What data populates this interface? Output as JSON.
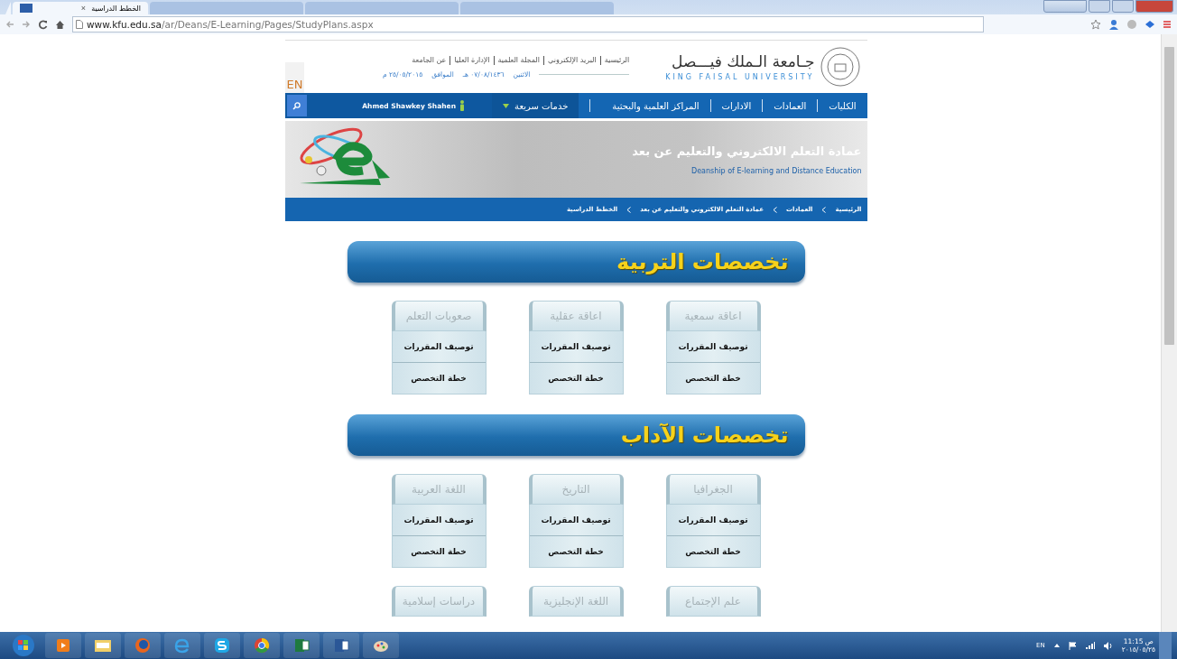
{
  "browser": {
    "tab_title": "الخطط الدراسية",
    "tab_close": "×",
    "url_host": "www.kfu.edu.sa",
    "url_path": "/ar/Deans/E-Learning/Pages/StudyPlans.aspx"
  },
  "header": {
    "links": [
      "الرئيسية",
      "البريد الإلكتروني",
      "المجلة العلمية",
      "الإدارة العليا",
      "عن الجامعة"
    ],
    "day": "الاثنين",
    "hijri": "٠٧/٠٨/١٤٣٦ هـ",
    "agree": "الموافق",
    "gregorian": "٢٥/٠٥/٢٠١٥ م",
    "university_ar": "جـامعة الـملك فيـــصل",
    "university_en": "KING FAISAL UNIVERSITY",
    "language": "EN"
  },
  "nav": {
    "items": [
      "الكليات",
      "العمادات",
      "الادارات",
      "المراكز العلمية والبحثية"
    ],
    "quick": "خدمات سريعة",
    "user": "Ahmed Shawkey Shahen"
  },
  "banner": {
    "title_ar": "عمادة التعلم الالكتروني والتعليم عن بعد",
    "title_en": "Deanship of E-learning and Distance Education"
  },
  "breadcrumb": [
    "الرئيسية",
    "العمادات",
    "عمادة التعلم الالكتروني والتعليم عن بعد",
    "الخطط الدراسية"
  ],
  "sections": [
    {
      "title": "تخصصات التربية",
      "cards": [
        {
          "title": "اعاقة سمعية",
          "links": [
            "توصيف المقررات",
            "خطة التخصص"
          ]
        },
        {
          "title": "اعاقة عقلية",
          "links": [
            "توصيف المقررات",
            "خطة التخصص"
          ]
        },
        {
          "title": "صعوبات التعلم",
          "links": [
            "توصيف المقررات",
            "خطة التخصص"
          ]
        }
      ]
    },
    {
      "title": "تخصصات الآداب",
      "cards": [
        {
          "title": "الجغرافيا",
          "links": [
            "توصيف المقررات",
            "خطة التخصص"
          ]
        },
        {
          "title": "التاريخ",
          "links": [
            "توصيف المقررات",
            "خطة التخصص"
          ]
        },
        {
          "title": "اللغة العربية",
          "links": [
            "توصيف المقررات",
            "خطة التخصص"
          ]
        },
        {
          "title": "علم الإجتماع"
        },
        {
          "title": "اللغة الإنجليزية"
        },
        {
          "title": "دراسات إسلامية"
        }
      ]
    }
  ],
  "taskbar": {
    "language": "EN",
    "time": "11:15 ص",
    "date": "٢٠١٥/٠٥/٢٥"
  }
}
